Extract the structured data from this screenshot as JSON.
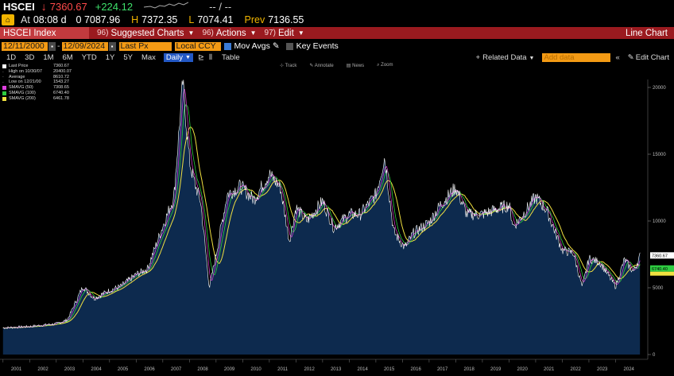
{
  "ticker": {
    "symbol": "HSCEI",
    "arrow": "↓",
    "last": "7360.67",
    "change": "+224.12",
    "dashes": "-- / --",
    "time_label": "At",
    "time": "08:08 d",
    "open": "0 7087.96",
    "high_label": "H",
    "high": "7372.35",
    "low_label": "L",
    "low": "7074.41",
    "prev_label": "Prev",
    "prev": "7136.55"
  },
  "menubar": {
    "security": "HSCEI Index",
    "menus": [
      {
        "num": "96)",
        "label": "Suggested Charts"
      },
      {
        "num": "96)",
        "label": "Actions"
      },
      {
        "num": "97)",
        "label": "Edit"
      }
    ],
    "chart_type": "Line Chart"
  },
  "daterow": {
    "start": "12/11/2000",
    "end": "12/09/2024",
    "field": "Last Px",
    "currency": "Local CCY",
    "mov_avgs": "Mov Avgs",
    "key_events": "Key Events"
  },
  "periodrow": {
    "periods": [
      "1D",
      "3D",
      "1M",
      "6M",
      "YTD",
      "1Y",
      "5Y",
      "Max"
    ],
    "frequency": "Daily",
    "table": "Table",
    "related": "Related Data",
    "add_placeholder": "Add data",
    "edit_chart": "Edit Chart"
  },
  "chart_tools": [
    "Track",
    "Annotate",
    "News",
    "Zoom"
  ],
  "legend": [
    {
      "label": "Last Price",
      "value": "7360.67",
      "color": "#ffffff"
    },
    {
      "label": "High on 10/30/07",
      "value": "20400.07",
      "color": ""
    },
    {
      "label": "Average",
      "value": "8610.72",
      "color": ""
    },
    {
      "label": "Low on 12/21/00",
      "value": "1543.27",
      "color": ""
    },
    {
      "label": "SMAVG (50)",
      "value": "7308.65",
      "color": "#e040e0"
    },
    {
      "label": "SMAVG (100)",
      "value": "6740.40",
      "color": "#2ecc40"
    },
    {
      "label": "SMAVG (200)",
      "value": "6461.78",
      "color": "#f0e040"
    }
  ],
  "chart_data": {
    "type": "area",
    "series": [
      {
        "name": "Last Price",
        "x": [
          "2001-01",
          "2002-01",
          "2003-01",
          "2003-06",
          "2004-01",
          "2004-06",
          "2005-01",
          "2005-06",
          "2006-01",
          "2006-06",
          "2007-01",
          "2007-06",
          "2007-10",
          "2008-01",
          "2008-03",
          "2008-06",
          "2008-10",
          "2009-01",
          "2009-06",
          "2009-12",
          "2010-06",
          "2011-01",
          "2011-06",
          "2011-10",
          "2012-01",
          "2012-06",
          "2013-01",
          "2013-06",
          "2014-01",
          "2014-06",
          "2015-01",
          "2015-05",
          "2015-09",
          "2016-02",
          "2016-06",
          "2017-01",
          "2017-06",
          "2018-01",
          "2018-06",
          "2019-01",
          "2019-06",
          "2020-01",
          "2020-03",
          "2020-06",
          "2021-01",
          "2021-06",
          "2022-01",
          "2022-06",
          "2022-10",
          "2023-01",
          "2023-06",
          "2024-01",
          "2024-05",
          "2024-09",
          "2024-12"
        ],
        "values": [
          2000,
          2100,
          2300,
          2600,
          5100,
          4200,
          4800,
          5100,
          6000,
          6400,
          9600,
          11800,
          20400,
          14500,
          13000,
          11500,
          5000,
          7500,
          12000,
          12600,
          11600,
          13500,
          12500,
          8500,
          11000,
          10000,
          11500,
          9500,
          10500,
          10500,
          12000,
          14800,
          9200,
          8000,
          9100,
          9900,
          11200,
          12500,
          10500,
          10500,
          10800,
          11200,
          9600,
          10200,
          11800,
          10800,
          7800,
          7600,
          5000,
          7200,
          6900,
          5100,
          7100,
          6200,
          7360
        ]
      }
    ],
    "moving_averages": [
      {
        "name": "SMAVG (200)",
        "color": "#f0e040"
      },
      {
        "name": "SMAVG (100)",
        "color": "#2ecc40"
      },
      {
        "name": "SMAVG (50)",
        "color": "#e040e0"
      }
    ],
    "x_ticks": [
      "2001",
      "2002",
      "2003",
      "2004",
      "2005",
      "2006",
      "2007",
      "2008",
      "2009",
      "2010",
      "2011",
      "2012",
      "2013",
      "2014",
      "2015",
      "2016",
      "2017",
      "2018",
      "2019",
      "2020",
      "2021",
      "2022",
      "2023",
      "2024"
    ],
    "y_ticks": [
      0,
      5000,
      10000,
      15000,
      20000
    ],
    "ylim": [
      0,
      21000
    ],
    "last_label": "7360.67",
    "ma_label": "6740.40",
    "grid": false
  }
}
